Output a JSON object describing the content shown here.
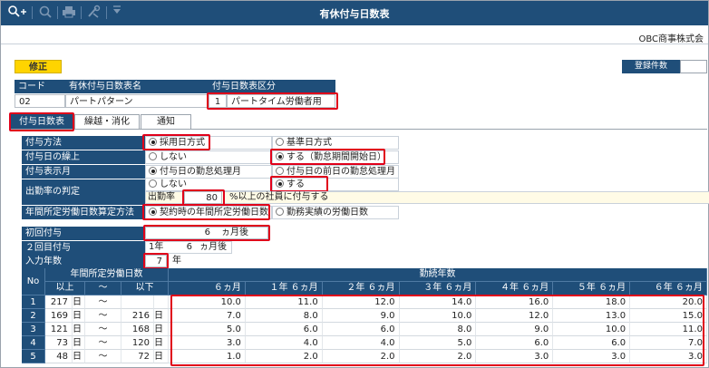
{
  "window": {
    "title": "有休付与日数表"
  },
  "company": "OBC商事株式会",
  "mode_badge": "修正",
  "registered_count_label": "登録件数",
  "header_table": {
    "code_label": "コード",
    "name_label": "有休付与日数表名",
    "category_label": "付与日数表区分",
    "code": "02",
    "name": "パートパターン",
    "category_code": "1",
    "category_name": "パートタイム労働者用"
  },
  "tabs": [
    {
      "label": "付与日数表",
      "active": true
    },
    {
      "label": "繰越・消化",
      "active": false
    },
    {
      "label": "通知",
      "active": false
    }
  ],
  "settings": {
    "grant_method": {
      "label": "付与方法",
      "options": [
        "採用日方式",
        "基準日方式"
      ],
      "selected": 0
    },
    "grant_advance": {
      "label": "付与日の繰上",
      "options": [
        "しない",
        "する（勤怠期間開始日）"
      ],
      "selected": 1
    },
    "grant_display_month": {
      "label": "付与表示月",
      "options": [
        "付与日の勤怠処理月",
        "付与日の前日の勤怠処理月"
      ],
      "selected": 0
    },
    "attendance_check": {
      "label": "出勤率の判定",
      "options": [
        "しない",
        "する"
      ],
      "selected": 1
    },
    "attendance_rate": {
      "prefix": "出勤率",
      "value": "80",
      "suffix": "%以上の社員に付与する"
    },
    "annual_days_method": {
      "label": "年間所定労働日数算定方法",
      "options": [
        "契約時の年間所定労働日数",
        "勤務実績の労働日数"
      ],
      "selected": 0
    }
  },
  "first_grant": {
    "label": "初回付与",
    "value": "6",
    "unit": "ヵ月後"
  },
  "second_grant": {
    "label": "２回目付与",
    "years": "1年",
    "months": "6",
    "unit": "ヵ月後"
  },
  "input_years": {
    "label": "入力年数",
    "value": "7",
    "unit": "年"
  },
  "grid": {
    "no_label": "No",
    "days_label": "年間所定労働日数",
    "over_label": "以上",
    "tilde": "～",
    "under_label": "以下",
    "service_label": "勤続年数",
    "columns": [
      "６ヵ月",
      "１年 ６ヵ月",
      "２年 ６ヵ月",
      "３年 ６ヵ月",
      "４年 ６ヵ月",
      "５年 ６ヵ月",
      "６年 ６ヵ月"
    ],
    "rows": [
      {
        "no": "1",
        "from": "217",
        "from_unit": "日",
        "to": "",
        "to_unit": "",
        "values": [
          "10.0",
          "11.0",
          "12.0",
          "14.0",
          "16.0",
          "18.0",
          "20.0"
        ]
      },
      {
        "no": "2",
        "from": "169",
        "from_unit": "日",
        "to": "216",
        "to_unit": "日",
        "values": [
          "7.0",
          "8.0",
          "9.0",
          "10.0",
          "12.0",
          "13.0",
          "15.0"
        ]
      },
      {
        "no": "3",
        "from": "121",
        "from_unit": "日",
        "to": "168",
        "to_unit": "日",
        "values": [
          "5.0",
          "6.0",
          "6.0",
          "8.0",
          "9.0",
          "10.0",
          "11.0"
        ]
      },
      {
        "no": "4",
        "from": "73",
        "from_unit": "日",
        "to": "120",
        "to_unit": "日",
        "values": [
          "3.0",
          "4.0",
          "4.0",
          "5.0",
          "6.0",
          "6.0",
          "7.0"
        ]
      },
      {
        "no": "5",
        "from": "48",
        "from_unit": "日",
        "to": "72",
        "to_unit": "日",
        "values": [
          "1.0",
          "2.0",
          "2.0",
          "2.0",
          "3.0",
          "3.0",
          "3.0"
        ]
      }
    ]
  },
  "colors": {
    "header_bg": "#1f4e79",
    "highlight": "#e0001a",
    "badge": "#ffd400"
  },
  "icons": [
    "search-plus-icon",
    "search-icon",
    "print-icon",
    "tools-icon",
    "dropdown-icon"
  ]
}
